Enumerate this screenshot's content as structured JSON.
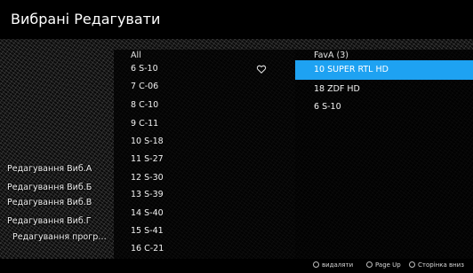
{
  "title": "Вибрані Редагувати",
  "sidebar": {
    "items": [
      {
        "label": "Редагування Виб.А"
      },
      {
        "label": "Редагування Виб.Б"
      },
      {
        "label": "Редагування Виб.В"
      },
      {
        "label": "Редагування Виб.Г"
      },
      {
        "label": "Редагування програм..."
      }
    ]
  },
  "all_list": {
    "header": "All",
    "channels": [
      {
        "label": "6 S-10",
        "favorite": true
      },
      {
        "label": "7 C-06",
        "favorite": false
      },
      {
        "label": "8 C-10",
        "favorite": false
      },
      {
        "label": "9 C-11",
        "favorite": false
      },
      {
        "label": "10 S-18",
        "favorite": false
      },
      {
        "label": "11 S-27",
        "favorite": false
      },
      {
        "label": "12 S-30",
        "favorite": false
      },
      {
        "label": "13 S-39",
        "favorite": false
      },
      {
        "label": "14 S-40",
        "favorite": false
      },
      {
        "label": "15 S-41",
        "favorite": false
      },
      {
        "label": "16 C-21",
        "favorite": false
      }
    ]
  },
  "fav_list": {
    "header": "FavA (3)",
    "channels": [
      {
        "label": "10 SUPER RTL HD",
        "selected": true
      },
      {
        "label": "18 ZDF HD",
        "selected": false
      },
      {
        "label": "6 S-10",
        "selected": false
      }
    ]
  },
  "hints": {
    "delete": "видаляти",
    "page_up": "Page Up",
    "page_down": "Сторінка вниз"
  },
  "colors": {
    "selection": "#1ea2f2",
    "titlebar": "#000000"
  },
  "icons": {
    "favorite": "heart-icon",
    "delete": "delete-key-icon",
    "page_up": "page-up-key-icon",
    "page_down": "page-down-key-icon"
  }
}
